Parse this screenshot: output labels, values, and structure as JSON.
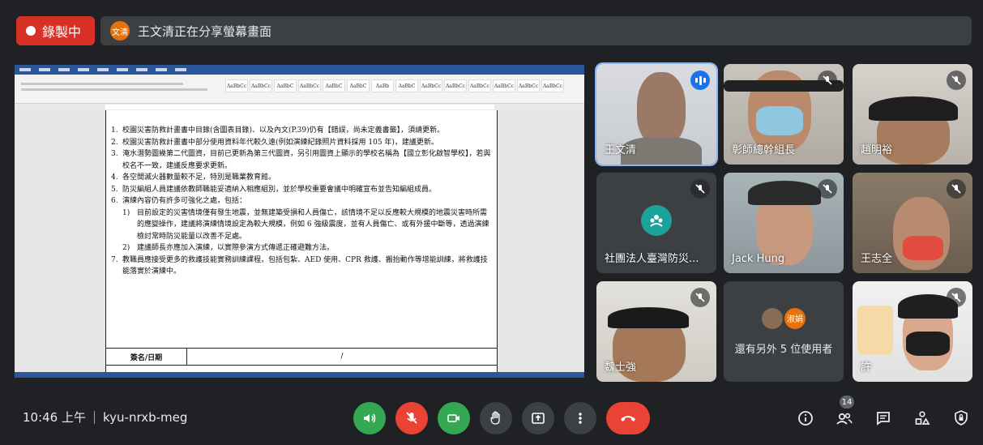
{
  "recording": {
    "label": "錄製中"
  },
  "share_banner": {
    "avatar_text": "文清",
    "text": "王文清正在分享螢幕畫面"
  },
  "shared_document": {
    "items": [
      {
        "n": "1.",
        "text": "校園災害防救計畫書中目錄(含圖表目錄)、以及內文(P.39)仍有【錯誤，尚未定義書籤】，須請更新。"
      },
      {
        "n": "2.",
        "text": "校園災害防救計畫書中部分使用資料年代較久遠(例如演練紀錄照片資料採用 105 年)，建議更新。"
      },
      {
        "n": "3.",
        "text": "淹水潛勢圖幾第二代圖資，目前已更新為第三代圖資，另引用圖資上顯示的學校名稱為【國立彰化啟智學校】，若與校名不一致，建議反應要求更新。"
      },
      {
        "n": "4.",
        "text": "各空間滅火器數量較不足，特別是職業教育館。"
      },
      {
        "n": "5.",
        "text": "防災編組人員建議依教師職能妥適納入相應組別，並於學校重要會議中明確宣布並告知編組成員。"
      },
      {
        "n": "6.",
        "text": "演練內容仍有許多可強化之處，包括："
      },
      {
        "n": "1)",
        "sub": true,
        "text": "目前設定的災害情境僅有發生地震，並無建築受損和人員傷亡，該情境不足以反應較大規模的地震災害時所需的應變操作，建議將演練情境設定為較大規模，例如 6 強級震度，並有人員傷亡、或有外援中斷等，透過演練檢討常時防災能量以改善不足處。"
      },
      {
        "n": "2)",
        "sub": true,
        "text": "建議師長亦應加入演練，以實際參演方式傳遞正確避難方法。"
      },
      {
        "n": "7.",
        "text": "教職員應接受更多的救護技能實務訓練課程，包括包紮、AED 使用、CPR 救護、搬抬動作等增能訓練，將救護技能落實於演練中。"
      }
    ],
    "sign_label": "簽名/日期",
    "sign_value": "/"
  },
  "participants": {
    "p1": "王文清",
    "p2": "彰師總幹組長",
    "p3": "趙明裕",
    "p4": "社團法人臺灣防災...",
    "p5": "Jack Hung",
    "p6": "王志全",
    "p7": "魏士強",
    "p8": "許"
  },
  "others": {
    "avatar_label": "淑娟",
    "text": "還有另外 5 位使用者"
  },
  "meeting": {
    "time": "10:46 上午",
    "code": "kyu-nrxb-meg"
  },
  "people_count": "14",
  "colors": {
    "record": "#d93025",
    "speaking": "#1a73e8",
    "hangup": "#ea4335",
    "camera_on": "#34a853"
  }
}
